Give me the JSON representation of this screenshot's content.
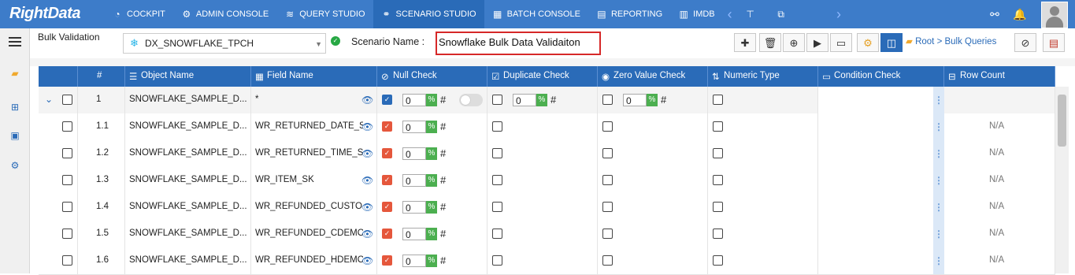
{
  "app": {
    "logo": "RightData",
    "nav": [
      {
        "label": "COCKPIT",
        "icon": "gauge-icon"
      },
      {
        "label": "ADMIN CONSOLE",
        "icon": "gear-icon"
      },
      {
        "label": "QUERY STUDIO",
        "icon": "database-icon"
      },
      {
        "label": "SCENARIO STUDIO",
        "icon": "flow-icon",
        "active": true
      },
      {
        "label": "BATCH CONSOLE",
        "icon": "batch-icon"
      },
      {
        "label": "REPORTING",
        "icon": "report-icon"
      },
      {
        "label": "IMDB",
        "icon": "imdb-icon"
      }
    ]
  },
  "toolbar": {
    "title": "Bulk Validation",
    "connection": "DX_SNOWFLAKE_TPCH",
    "scenario_label": "Scenario Name :",
    "scenario_name": "Snowflake Bulk Data Validaiton",
    "breadcrumb_root": "Root",
    "breadcrumb_sep": ">",
    "breadcrumb_leaf": "Bulk Queries"
  },
  "grid": {
    "headers": {
      "num": "#",
      "object_name": "Object Name",
      "field_name": "Field Name",
      "null_check": "Null Check",
      "duplicate_check": "Duplicate Check",
      "zero_value_check": "Zero Value Check",
      "numeric_type": "Numeric Type",
      "condition_check": "Condition Check",
      "row_count": "Row Count"
    },
    "rows": [
      {
        "num": "1",
        "object": "SNOWFLAKE_SAMPLE_D...",
        "field": "*",
        "null_pct": "0",
        "dup_pct": "0",
        "zero_pct": "0",
        "row_count": ""
      },
      {
        "num": "1.1",
        "object": "SNOWFLAKE_SAMPLE_D...",
        "field": "WR_RETURNED_DATE_SK",
        "null_pct": "0",
        "row_count": "N/A"
      },
      {
        "num": "1.2",
        "object": "SNOWFLAKE_SAMPLE_D...",
        "field": "WR_RETURNED_TIME_SK",
        "null_pct": "0",
        "row_count": "N/A"
      },
      {
        "num": "1.3",
        "object": "SNOWFLAKE_SAMPLE_D...",
        "field": "WR_ITEM_SK",
        "null_pct": "0",
        "row_count": "N/A"
      },
      {
        "num": "1.4",
        "object": "SNOWFLAKE_SAMPLE_D...",
        "field": "WR_REFUNDED_CUSTO...",
        "null_pct": "0",
        "row_count": "N/A"
      },
      {
        "num": "1.5",
        "object": "SNOWFLAKE_SAMPLE_D...",
        "field": "WR_REFUNDED_CDEMO...",
        "null_pct": "0",
        "row_count": "N/A"
      },
      {
        "num": "1.6",
        "object": "SNOWFLAKE_SAMPLE_D...",
        "field": "WR_REFUNDED_HDEMO...",
        "null_pct": "0",
        "row_count": "N/A"
      }
    ],
    "pct_symbol": "%",
    "hash_symbol": "#"
  },
  "colors": {
    "topbar": "#3d7cc9",
    "header": "#2a6bb8",
    "checked_red": "#e5573c",
    "pct_green": "#4caf50",
    "highlight_red": "#d62828"
  }
}
